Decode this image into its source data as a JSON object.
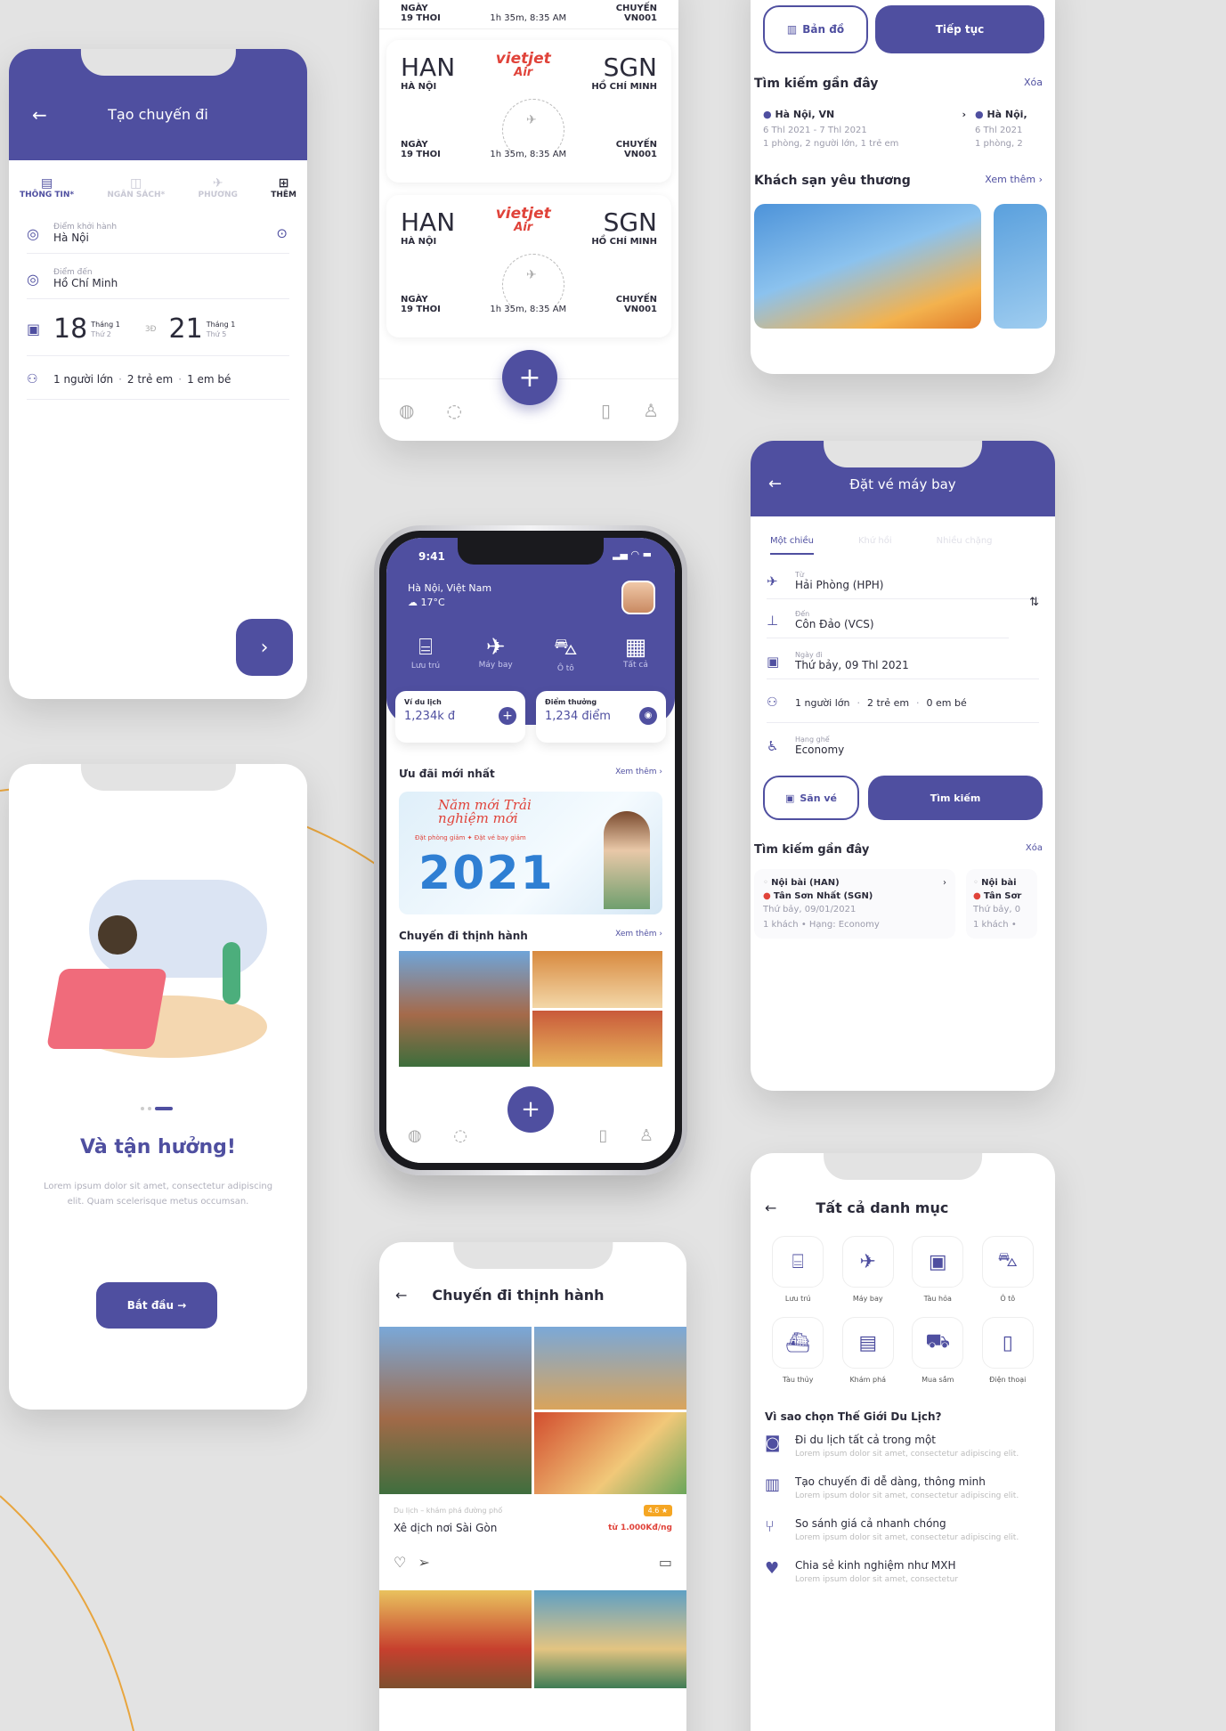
{
  "colors": {
    "primary": "#4f4fa0",
    "bg": "#e3e3e3",
    "accent": "#e8a53e",
    "red": "#e0433a"
  },
  "create_trip": {
    "title": "Tạo chuyến đi",
    "tabs": [
      {
        "label": "THÔNG TIN*",
        "icon": "document-icon"
      },
      {
        "label": "NGÂN SÁCH*",
        "icon": "wallet-icon"
      },
      {
        "label": "PHƯƠNG",
        "icon": "plane-icon"
      },
      {
        "label": "THÊM",
        "icon": "plus-square-icon"
      }
    ],
    "from_label": "Điểm khởi hành",
    "from_value": "Hà Nội",
    "to_label": "Điểm đến",
    "to_value": "Hồ Chí Minh",
    "date1_day": "18",
    "date1_month": "Tháng 1",
    "date1_weekday": "Thứ 2",
    "nights": "3Đ",
    "date2_day": "21",
    "date2_month": "Tháng 1",
    "date2_weekday": "Thứ 5",
    "pax_adults": "1 người lớn",
    "pax_children": "2 trẻ em",
    "pax_infants": "1 em bé"
  },
  "flights": {
    "top_left": "NGÀY\n19 THOI",
    "top_mid": "1h 35m, 8:35 AM",
    "top_right": "CHUYẾN\nVN001",
    "items": [
      {
        "from_code": "HAN",
        "from_city": "HÀ NỘI",
        "airline": "Vietjet Air",
        "to_code": "SGN",
        "to_city": "HỒ CHÍ MINH",
        "date_label": "NGÀY",
        "date_value": "19 THOI",
        "duration": "1h 35m, 8:35 AM",
        "flight_label": "CHUYẾN",
        "flight_value": "VN001"
      },
      {
        "from_code": "HAN",
        "from_city": "HÀ NỘI",
        "airline": "Vietjet Air",
        "to_code": "SGN",
        "to_city": "HỒ CHÍ MINH",
        "date_label": "NGÀY",
        "date_value": "19 THOI",
        "duration": "1h 35m, 8:35 AM",
        "flight_label": "CHUYẾN",
        "flight_value": "VN001"
      }
    ]
  },
  "hotel_search": {
    "map_btn": "Bản đồ",
    "continue_btn": "Tiếp tục",
    "recent_title": "Tìm kiếm gần đây",
    "clear": "Xóa",
    "recent": [
      {
        "city": "Hà Nội, VN",
        "dates": "6 Thl 2021 - 7 Thl 2021",
        "rooms": "1 phòng, 2 người lớn, 1 trẻ em"
      },
      {
        "city": "Hà Nội,",
        "dates": "6 Thl 2021",
        "rooms": "1 phòng, 2"
      }
    ],
    "fav_title": "Khách sạn yêu thương",
    "see_more": "Xem thêm"
  },
  "home": {
    "time": "9:41",
    "location": "Hà Nội, Việt Nam",
    "weather": "17°C",
    "categories": [
      {
        "label": "Lưu trú",
        "icon": "bed-icon"
      },
      {
        "label": "Máy bay",
        "icon": "plane-icon"
      },
      {
        "label": "Ô tô",
        "icon": "car-icon"
      },
      {
        "label": "Tất cả",
        "icon": "grid-icon"
      }
    ],
    "wallet_label": "Ví du lịch",
    "wallet_value": "1,234k đ",
    "points_label": "Điểm thưởng",
    "points_value": "1,234 điểm",
    "deals_title": "Ưu đãi mới nhất",
    "see_more": "Xem thêm",
    "banner_script": "Năm mới Trải nghiệm mới",
    "banner_sub1": "Đặt phòng giảm",
    "banner_sub2": "Đặt vé bay giảm",
    "banner_year": "2021",
    "trending_title": "Chuyến đi thịnh hành",
    "trending_more": "Xem thêm"
  },
  "flight_booking": {
    "title": "Đặt vé máy bay",
    "tabs": [
      "Một chiều",
      "Khứ hồi",
      "Nhiều chặng"
    ],
    "from_label": "Từ",
    "from_value": "Hải Phòng (HPH)",
    "to_label": "Đến",
    "to_value": "Côn Đảo (VCS)",
    "date_label": "Ngày đi",
    "date_value": "Thứ bảy, 09 Thl 2021",
    "pax_adults": "1 người lớn",
    "pax_children": "2 trẻ em",
    "pax_infants": "0 em bé",
    "class_label": "Hạng ghế",
    "class_value": "Economy",
    "deals_btn": "Săn vé",
    "search_btn": "Tìm kiếm",
    "recent_title": "Tìm kiếm gần đây",
    "clear": "Xóa",
    "recent": [
      {
        "from": "Nội bài (HAN)",
        "to": "Tân Sơn Nhất (SGN)",
        "date": "Thứ bảy, 09/01/2021",
        "info": "1 khách • Hạng: Economy"
      },
      {
        "from": "Nội bài",
        "to": "Tân Sơr",
        "date": "Thứ bảy, 0",
        "info": "1 khách •"
      }
    ]
  },
  "onboarding": {
    "title": "Và tận hưởng!",
    "body": "Lorem ipsum dolor sit amet, consectetur adipiscing elit. Quam scelerisque metus occumsan.",
    "button": "Bắt đầu →"
  },
  "trending": {
    "title": "Chuyến đi thịnh hành",
    "caption": "Du lịch – khám phá đường phố",
    "rating": "4.6 ★",
    "name": "Xê dịch nơi Sài Gòn",
    "price": "từ 1.000Kđ/ng"
  },
  "categories_page": {
    "title": "Tất cả danh mục",
    "items": [
      {
        "label": "Lưu trú",
        "icon": "bed-icon"
      },
      {
        "label": "Máy bay",
        "icon": "plane-icon"
      },
      {
        "label": "Tàu hỏa",
        "icon": "train-icon"
      },
      {
        "label": "Ô tô",
        "icon": "car-icon"
      },
      {
        "label": "Tàu thủy",
        "icon": "ship-icon"
      },
      {
        "label": "Khám phá",
        "icon": "explore-icon"
      },
      {
        "label": "Mua sắm",
        "icon": "cart-icon"
      },
      {
        "label": "Điện thoại",
        "icon": "phone-icon"
      }
    ],
    "why_title": "Vì sao chọn Thế Giới Du Lịch?",
    "reasons": [
      {
        "title": "Đi du lịch tất cả trong một",
        "desc": "Lorem ipsum dolor sit amet, consectetur adipiscing elit.",
        "icon": "camera-icon"
      },
      {
        "title": "Tạo chuyến đi dễ dàng, thông minh",
        "desc": "Lorem ipsum dolor sit amet, consectetur adipiscing elit.",
        "icon": "map-icon"
      },
      {
        "title": "So sánh giá cả nhanh chóng",
        "desc": "Lorem ipsum dolor sit amet, consectetur adipiscing elit.",
        "icon": "route-icon"
      },
      {
        "title": "Chia sẻ kinh nghiệm như MXH",
        "desc": "Lorem ipsum dolor sit amet, consectetur",
        "icon": "heart-hand-icon"
      }
    ]
  }
}
